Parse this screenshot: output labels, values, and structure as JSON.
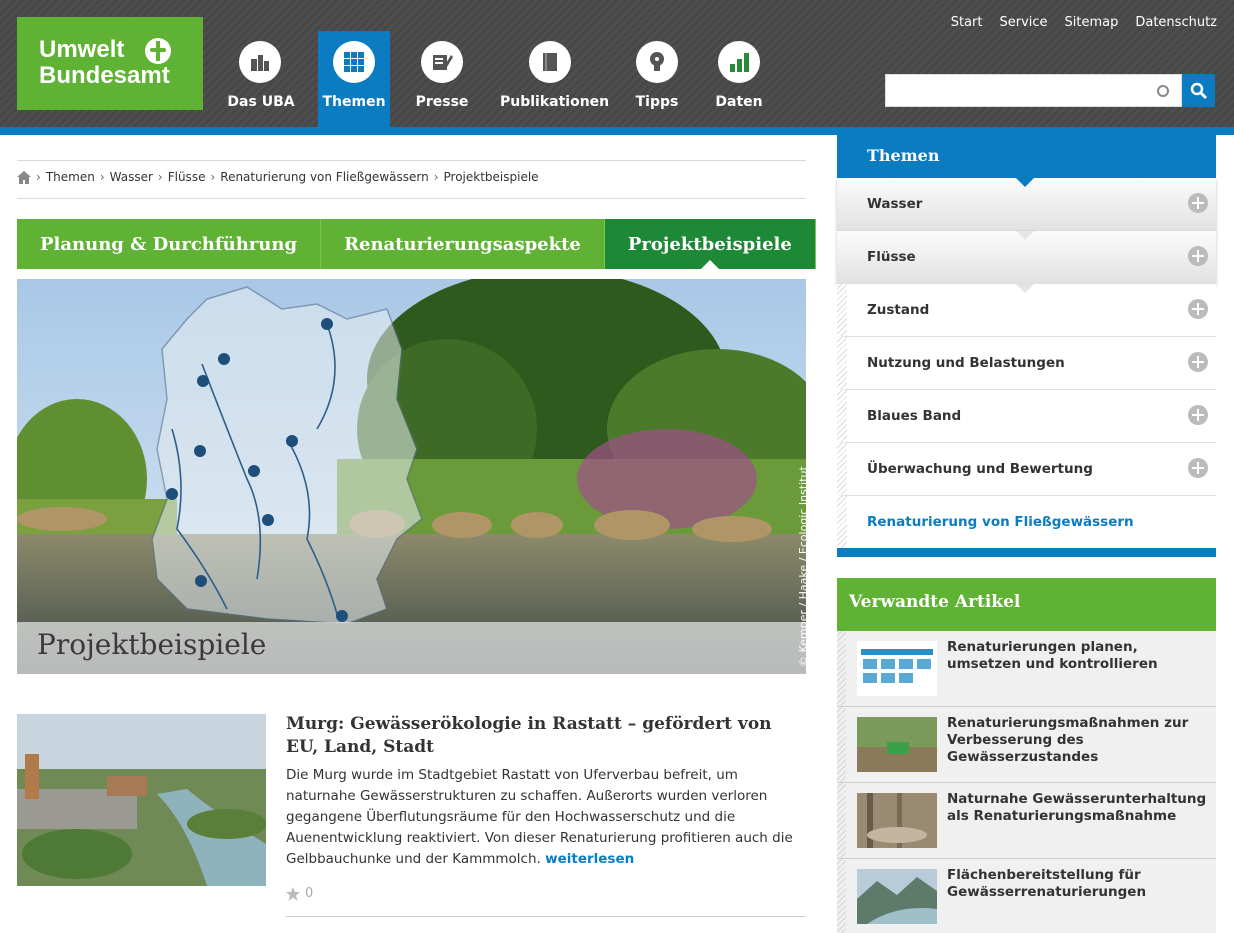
{
  "logo": {
    "line1": "Umwelt",
    "line2": "Bundesamt"
  },
  "nav": [
    {
      "label": "Das UBA",
      "icon": "buildings-icon"
    },
    {
      "label": "Themen",
      "icon": "grid-icon"
    },
    {
      "label": "Presse",
      "icon": "newspaper-pen-icon"
    },
    {
      "label": "Publikationen",
      "icon": "book-icon"
    },
    {
      "label": "Tipps",
      "icon": "lightbulb-icon"
    },
    {
      "label": "Daten",
      "icon": "bar-chart-icon"
    }
  ],
  "top_links": [
    "Start",
    "Service",
    "Sitemap",
    "Datenschutz"
  ],
  "search": {
    "placeholder": ""
  },
  "breadcrumb": [
    "Themen",
    "Wasser",
    "Flüsse",
    "Renaturierung von Fließgewässern",
    "Projektbeispiele"
  ],
  "tabs": [
    "Planung & Durchführung",
    "Renaturierungsaspekte",
    "Projektbeispiele"
  ],
  "hero": {
    "caption": "Projektbeispiele",
    "credit": "© Kemper / Haake / Ecologic Institut"
  },
  "article": {
    "title": "Murg: Gewässerökologie in Rastatt – gefördert von EU, Land, Stadt",
    "text": "Die Murg wurde im Stadtgebiet Rastatt von Uferverbau befreit, um naturnahe Gewässerstrukturen zu schaffen. Außerorts wurden verloren gegangene Überflutungsräume für den Hochwasserschutz und die Auenentwicklung reaktiviert. Von dieser Renaturierung profitieren auch die Gelbbauchunke und der Kammmolch.",
    "more": "weiterlesen",
    "rating": "0"
  },
  "sidebar": {
    "title": "Themen",
    "items": [
      "Wasser",
      "Flüsse",
      "Zustand",
      "Nutzung und Belastungen",
      "Blaues Band",
      "Überwachung und Bewertung",
      "Renaturierung von Fließgewässern"
    ]
  },
  "related": {
    "title": "Verwandte Artikel",
    "items": [
      "Renaturierungen planen, umsetzen und kontrollieren",
      "Renaturierungsmaßnahmen zur Verbesserung des Gewässerzustandes",
      "Naturnahe Gewässerunterhaltung als Renaturierungsmaßnahme",
      "Flächenbereitstellung für Gewässerrenaturierungen"
    ]
  },
  "colors": {
    "brand_green": "#5fb233",
    "dark_green": "#1d8936",
    "blue": "#0b7cc1",
    "header_gray": "#4e4e4e"
  }
}
